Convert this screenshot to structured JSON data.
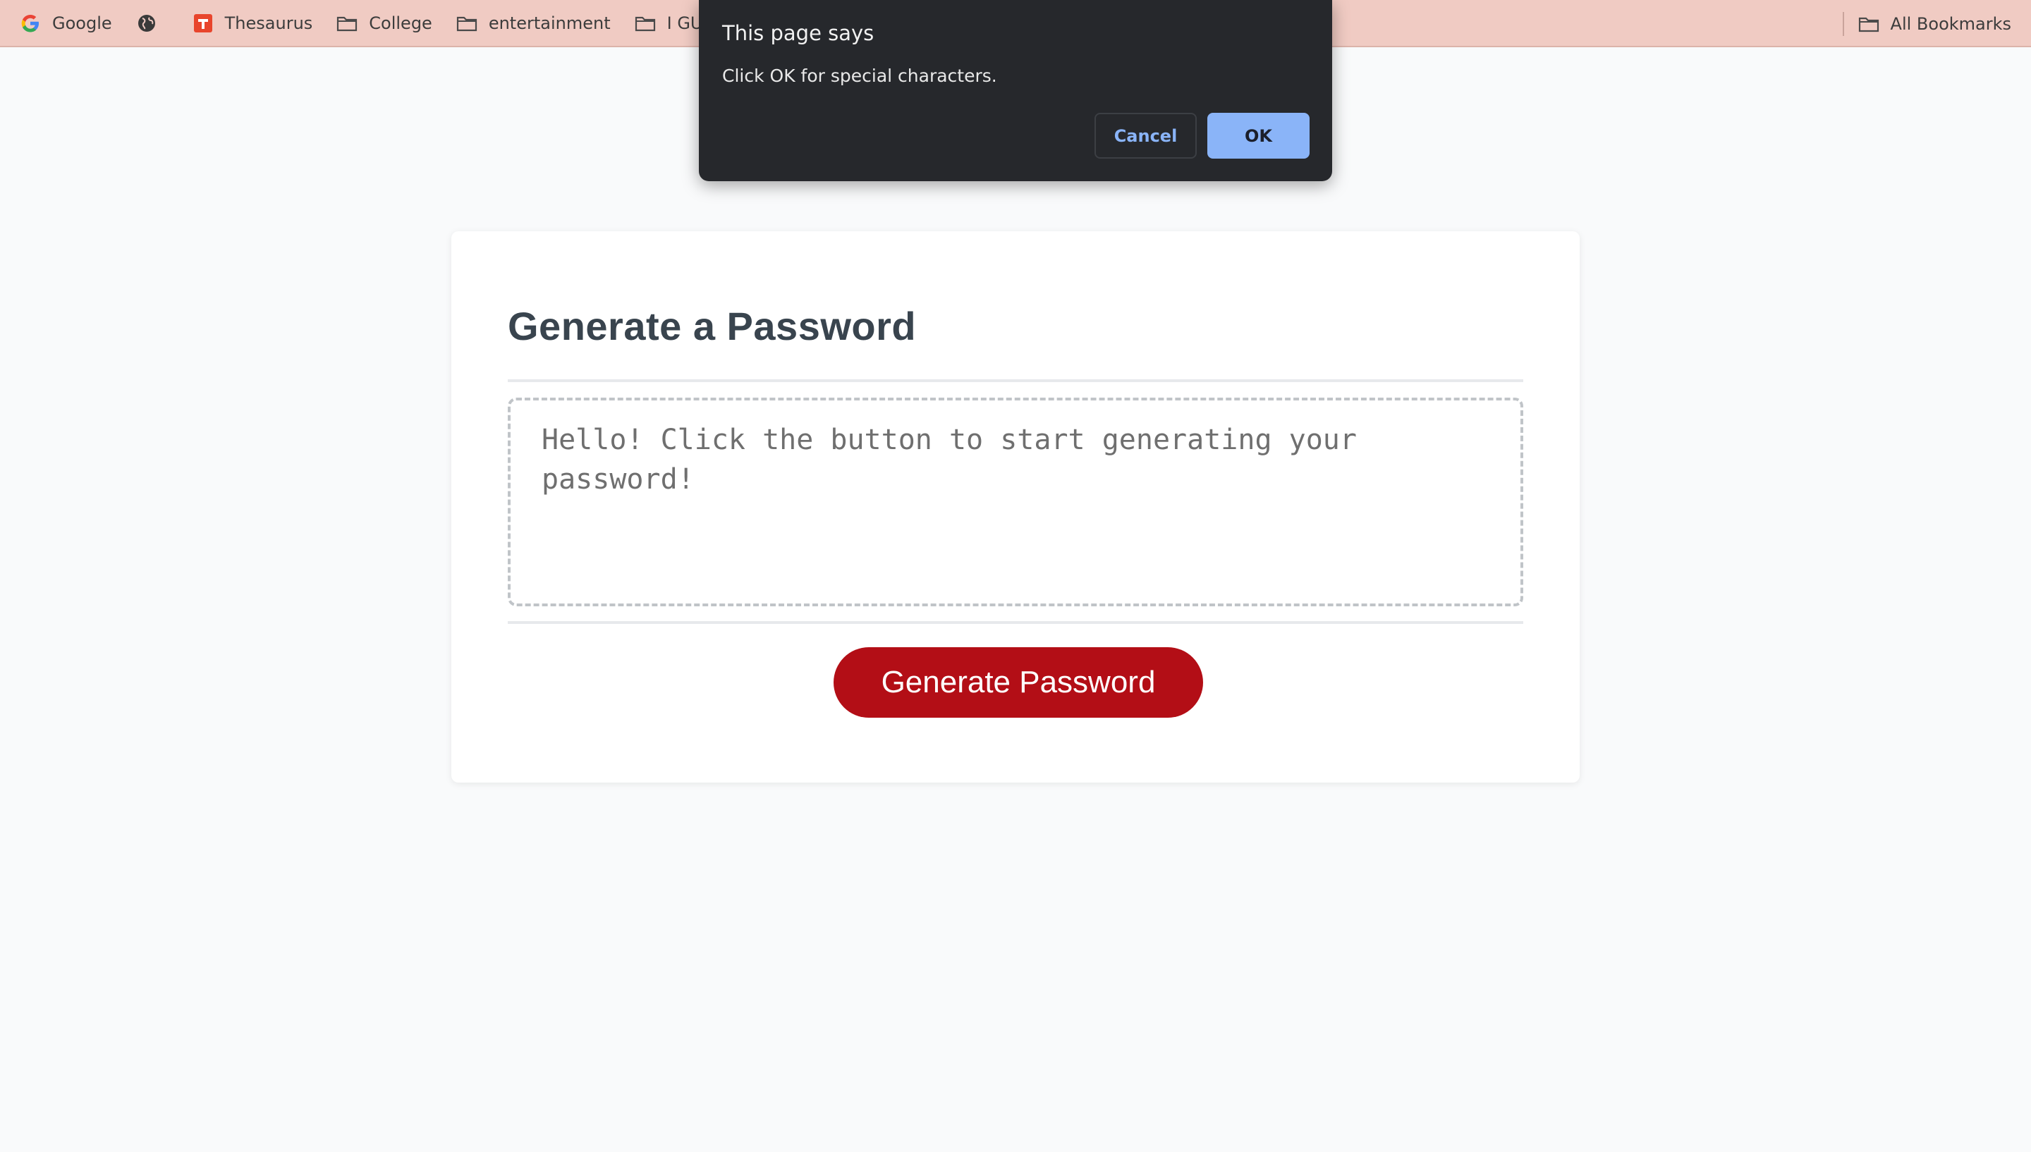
{
  "bookmarks": {
    "items": [
      {
        "label": "Google",
        "icon": "google-icon"
      },
      {
        "label": "",
        "icon": "globe-icon"
      },
      {
        "label": "Thesaurus",
        "icon": "thesaurus-icon"
      },
      {
        "label": "College",
        "icon": "folder-icon"
      },
      {
        "label": "entertainment",
        "icon": "folder-icon"
      },
      {
        "label": "I GUESS",
        "icon": "folder-icon"
      }
    ],
    "all_bookmarks": "All Bookmarks"
  },
  "dialog": {
    "title": "This page says",
    "message": "Click OK for special characters.",
    "cancel_label": "Cancel",
    "ok_label": "OK"
  },
  "card": {
    "title": "Generate a Password",
    "password_placeholder": "Hello! Click the button to start generating your password!",
    "button_label": "Generate Password"
  },
  "colors": {
    "bookmarks_bar": "#f0cbc3",
    "button_red": "#b30e16",
    "dialog_bg": "#26282c",
    "ok_blue": "#8ab4f8"
  }
}
